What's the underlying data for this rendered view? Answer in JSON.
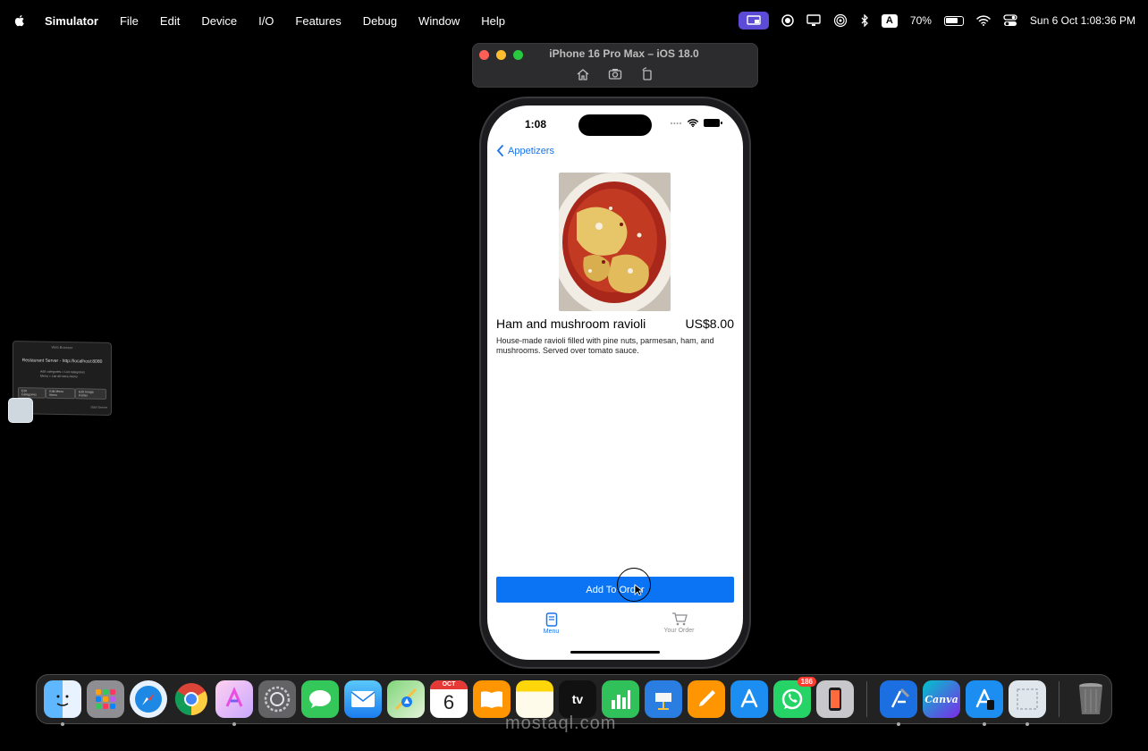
{
  "menubar": {
    "app_name": "Simulator",
    "items": [
      "File",
      "Edit",
      "Device",
      "I/O",
      "Features",
      "Debug",
      "Window",
      "Help"
    ],
    "battery_pct": "70%",
    "keyboard_letter": "A",
    "datetime": "Sun 6 Oct  1:08:36 PM"
  },
  "simulator": {
    "title": "iPhone 16 Pro Max – iOS 18.0"
  },
  "phone": {
    "status_time": "1:08",
    "back_label": "Appetizers",
    "item_name": "Ham and mushroom ravioli",
    "item_price": "US$8.00",
    "item_description": "House-made ravioli filled with pine nuts, parmesan, ham, and mushrooms. Served over tomato sauce.",
    "add_button": "Add To Order",
    "tabs": [
      {
        "label": "Menu",
        "icon": "menu-book-icon",
        "active": true
      },
      {
        "label": "Your Order",
        "icon": "cart-icon",
        "active": false
      }
    ]
  },
  "mini_window": {
    "title": "Web Browser",
    "heading": "Restaurant Server - http://localhost:8080",
    "lines": [
      "Add categories = List categories",
      "Menu = List all menu items"
    ],
    "buttons": [
      "Edit Categories",
      "Edit Menu Items",
      "Edit Image Folder"
    ],
    "footer": "Start Server"
  },
  "dock": {
    "apps": [
      {
        "name": "Finder",
        "icon": "finder-icon",
        "color": "#2f8cf0",
        "running": true
      },
      {
        "name": "Launchpad",
        "icon": "launchpad-icon",
        "color": "#8e8e93",
        "running": false
      },
      {
        "name": "Safari",
        "icon": "safari-icon",
        "color": "#1e88e5",
        "running": false
      },
      {
        "name": "Chrome",
        "icon": "chrome-icon",
        "color": "#ffffff",
        "running": false
      },
      {
        "name": "Claude",
        "icon": "ai-app-icon",
        "color": "#e97cf0",
        "running": true
      },
      {
        "name": "System Settings",
        "icon": "settings-icon",
        "color": "#6e6e73",
        "running": false
      },
      {
        "name": "Messages",
        "icon": "messages-icon",
        "color": "#34c759",
        "running": false
      },
      {
        "name": "Mail",
        "icon": "mail-icon",
        "color": "#2d8cf0",
        "running": false
      },
      {
        "name": "Maps",
        "icon": "maps-icon",
        "color": "#5ac8fa",
        "running": false
      },
      {
        "name": "Calendar",
        "icon": "calendar-icon",
        "color": "#ffffff",
        "running": false,
        "month": "OCT",
        "day": "6"
      },
      {
        "name": "Books",
        "icon": "books-icon",
        "color": "#ff9500",
        "running": false
      },
      {
        "name": "Notes",
        "icon": "notes-icon",
        "color": "#ffcc00",
        "running": false
      },
      {
        "name": "TV",
        "icon": "tv-icon",
        "color": "#111111",
        "running": false,
        "label": "tv"
      },
      {
        "name": "Numbers",
        "icon": "numbers-icon",
        "color": "#30c15a",
        "running": false
      },
      {
        "name": "Keynote",
        "icon": "keynote-icon",
        "color": "#2a7de1",
        "running": false
      },
      {
        "name": "Pages",
        "icon": "pages-icon",
        "color": "#ff9500",
        "running": false
      },
      {
        "name": "App Store",
        "icon": "appstore-icon",
        "color": "#1c8ef2",
        "running": false
      },
      {
        "name": "WhatsApp",
        "icon": "whatsapp-icon",
        "color": "#25d366",
        "running": false,
        "badge": "186"
      },
      {
        "name": "iPhone Mirroring",
        "icon": "iphone-icon",
        "color": "#c7c7cc",
        "running": false
      }
    ],
    "apps_right": [
      {
        "name": "Xcode",
        "icon": "xcode-icon",
        "color": "#1c6fe0",
        "running": true
      },
      {
        "name": "Canva",
        "icon": "canva-icon",
        "color": "#6c3ce0",
        "running": false,
        "label": "Canva"
      },
      {
        "name": "Simulator",
        "icon": "simulator-icon",
        "color": "#1c8ef2",
        "running": true
      },
      {
        "name": "Preview",
        "icon": "preview-icon",
        "color": "#dfe6ec",
        "running": true
      }
    ],
    "trash": {
      "name": "Trash",
      "icon": "trash-icon"
    }
  },
  "watermark": "mostaql.com"
}
